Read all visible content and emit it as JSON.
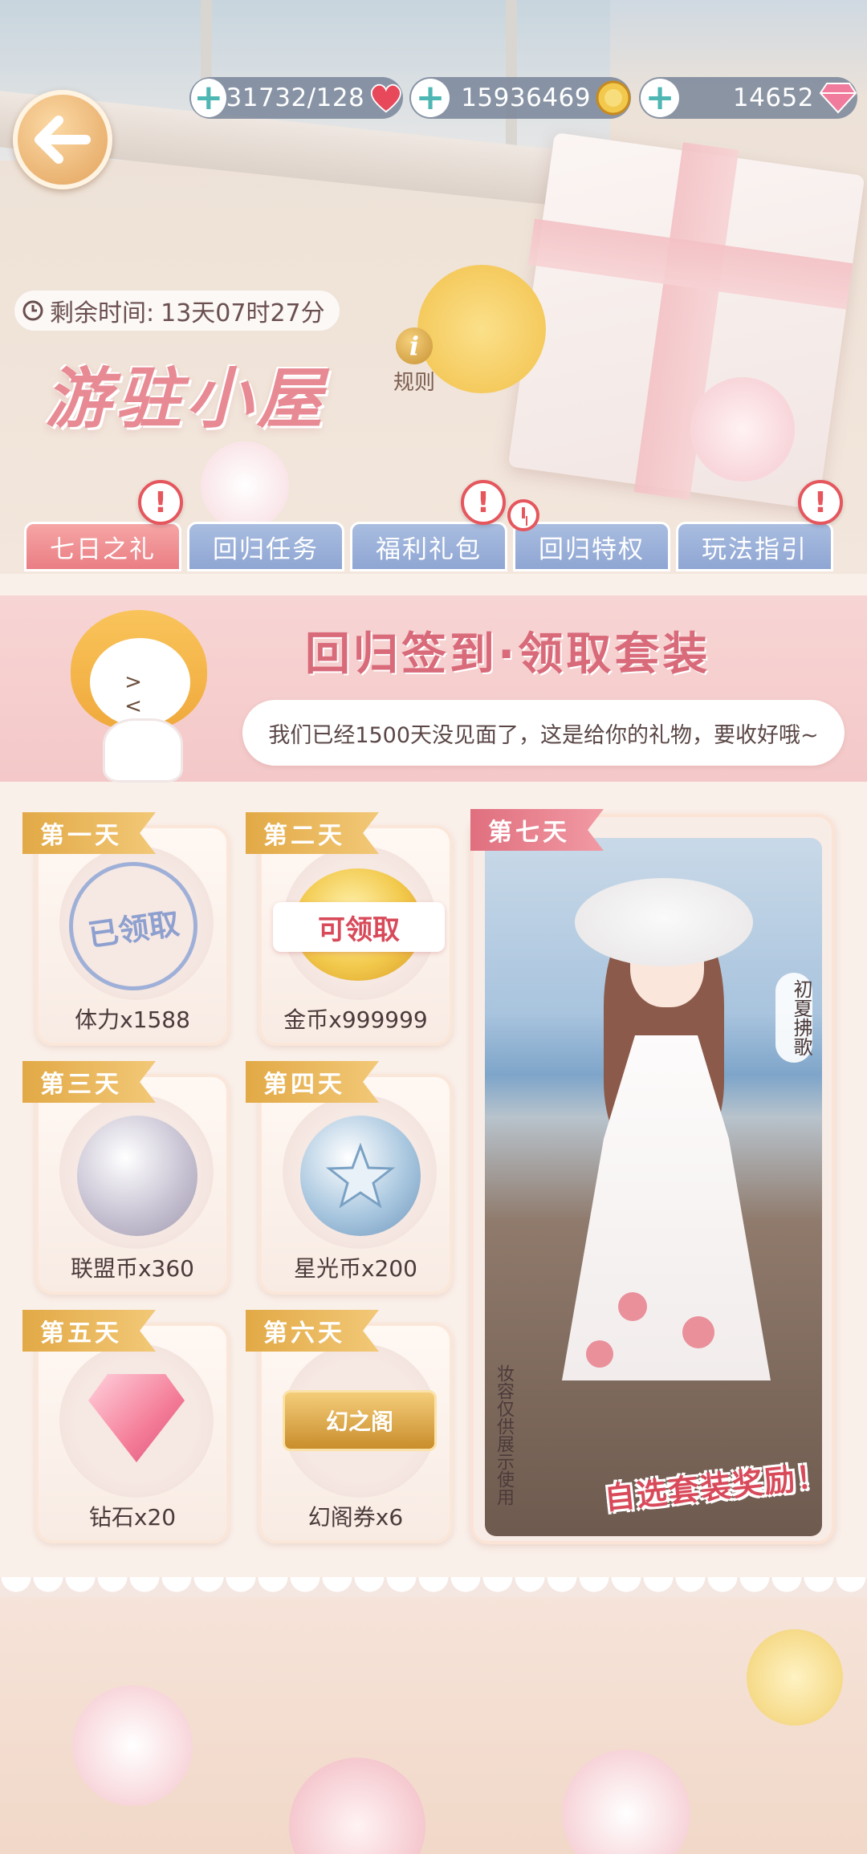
{
  "resources": [
    {
      "value": "31732/128",
      "icon": "heart-icon"
    },
    {
      "value": "15936469",
      "icon": "coin-icon"
    },
    {
      "value": "14652",
      "icon": "diamond-icon"
    }
  ],
  "header": {
    "timer_label": "剩余时间:",
    "timer_value": "13天07时27分",
    "title": "游驻小屋",
    "rules_label": "规则"
  },
  "tabs": [
    {
      "label": "七日之礼",
      "active": true
    },
    {
      "label": "回归任务"
    },
    {
      "label": "福利礼包"
    },
    {
      "label": "回归特权"
    },
    {
      "label": "玩法指引"
    }
  ],
  "banner": {
    "title": "回归签到·领取套装",
    "message": "我们已经1500天没见面了，这是给你的礼物，要收好哦~"
  },
  "days": [
    {
      "day": "第一天",
      "reward": "体力x1588",
      "status": "已领取"
    },
    {
      "day": "第二天",
      "reward": "金币x999999",
      "status": "可领取"
    },
    {
      "day": "第三天",
      "reward": "联盟币x360"
    },
    {
      "day": "第四天",
      "reward": "星光币x200"
    },
    {
      "day": "第五天",
      "reward": "钻石x20"
    },
    {
      "day": "第六天",
      "reward": "幻阁券x6",
      "ticket_text": "幻之阁"
    }
  ],
  "day7": {
    "day": "第七天",
    "outfit_name": "初夏拂歌",
    "note": "妆容仅供展示使用",
    "badge": "自选套装奖励！"
  },
  "colors": {
    "accent": "#e88a94",
    "tab_active": "#ea7e84",
    "tab_inactive": "#8fa6d3",
    "day_label": "#e2a946",
    "alert": "#e5565d"
  }
}
